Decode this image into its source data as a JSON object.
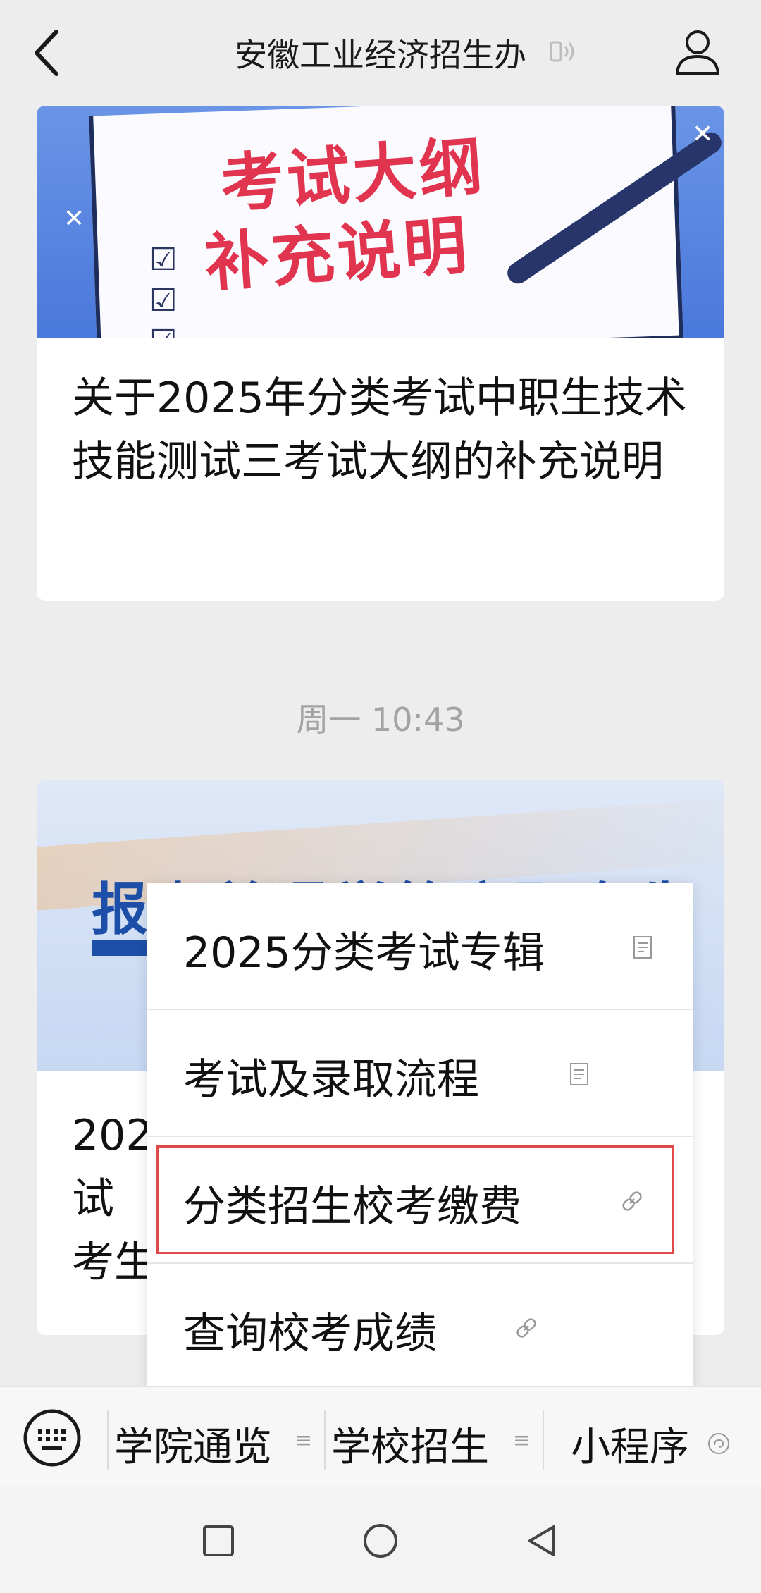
{
  "header": {
    "title": "安徽工业经济招生办"
  },
  "feed": {
    "article1": {
      "banner_line1": "考试大纲",
      "banner_line2": "补充说明",
      "title": "关于2025年分类考试中职生技术技能测试三考试大纲的补充说明"
    },
    "timestamp": "周一 10:43",
    "article2": {
      "banner_text": "报考普通学籍高职专生",
      "title_visible_line1": "202",
      "title_visible_line2": "试",
      "title_visible_line3": "考生"
    }
  },
  "menu": {
    "items": [
      {
        "label": "2025分类考试专辑",
        "icon": "article-icon"
      },
      {
        "label": "考试及录取流程",
        "icon": "article-icon"
      },
      {
        "label": "分类招生校考缴费",
        "icon": "link-icon"
      },
      {
        "label": "查询校考成绩",
        "icon": "link-icon"
      }
    ],
    "highlight_color": "#e04a4a"
  },
  "bottom_menu": {
    "items": [
      {
        "label": "学院通览",
        "icon": "≡"
      },
      {
        "label": "学校招生",
        "icon": "≡"
      },
      {
        "label": "小程序",
        "icon": "mini-program-icon"
      }
    ]
  },
  "colors": {
    "background": "#ededed",
    "banner_title_red": "#e0344f",
    "banner_blue": "#1e4fa8"
  }
}
